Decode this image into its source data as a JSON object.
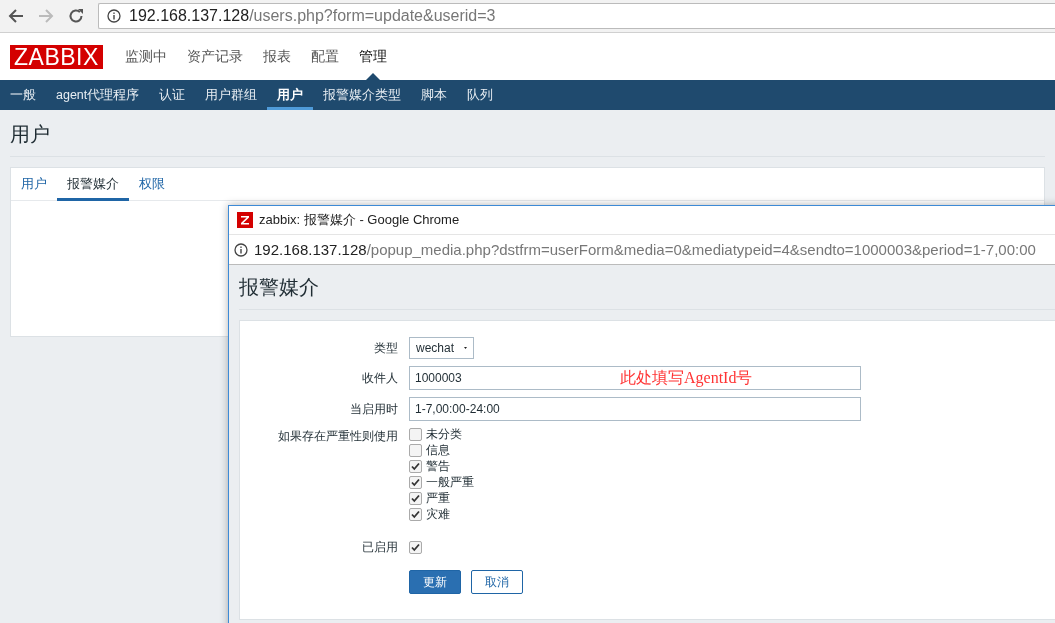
{
  "browser": {
    "url_host": "192.168.137.128",
    "url_path": "/users.php?form=update&userid=3"
  },
  "header": {
    "logo": "ZABBIX",
    "menu": [
      {
        "label": "监测中",
        "selected": false
      },
      {
        "label": "资产记录",
        "selected": false
      },
      {
        "label": "报表",
        "selected": false
      },
      {
        "label": "配置",
        "selected": false
      },
      {
        "label": "管理",
        "selected": true
      }
    ]
  },
  "subnav": [
    {
      "label": "一般",
      "selected": false
    },
    {
      "label": "agent代理程序",
      "selected": false
    },
    {
      "label": "认证",
      "selected": false
    },
    {
      "label": "用户群组",
      "selected": false
    },
    {
      "label": "用户",
      "selected": true
    },
    {
      "label": "报警媒介类型",
      "selected": false
    },
    {
      "label": "脚本",
      "selected": false
    },
    {
      "label": "队列",
      "selected": false
    }
  ],
  "page_title": "用户",
  "tabs": [
    {
      "label": "用户",
      "selected": false
    },
    {
      "label": "报警媒介",
      "selected": true
    },
    {
      "label": "权限",
      "selected": false
    }
  ],
  "popup": {
    "title": "zabbix: 报警媒介 - Google Chrome",
    "url_host": "192.168.137.128",
    "url_path": "/popup_media.php?dstfrm=userForm&media=0&mediatypeid=4&sendto=1000003&period=1-7,00:00",
    "heading": "报警媒介",
    "form": {
      "type": {
        "label": "类型",
        "value": "wechat"
      },
      "sendto": {
        "label": "收件人",
        "value": "1000003",
        "annotation": "此处填写AgentId号"
      },
      "period": {
        "label": "当启用时",
        "value": "1-7,00:00-24:00"
      },
      "severity": {
        "label": "如果存在严重性则使用",
        "options": [
          {
            "label": "未分类",
            "checked": false
          },
          {
            "label": "信息",
            "checked": false
          },
          {
            "label": "警告",
            "checked": true
          },
          {
            "label": "一般严重",
            "checked": true
          },
          {
            "label": "严重",
            "checked": true
          },
          {
            "label": "灾难",
            "checked": true
          }
        ]
      },
      "enabled": {
        "label": "已启用",
        "checked": true
      }
    },
    "buttons": [
      {
        "label": "更新",
        "kind": "primary"
      },
      {
        "label": "取消",
        "kind": "secondary"
      }
    ]
  }
}
